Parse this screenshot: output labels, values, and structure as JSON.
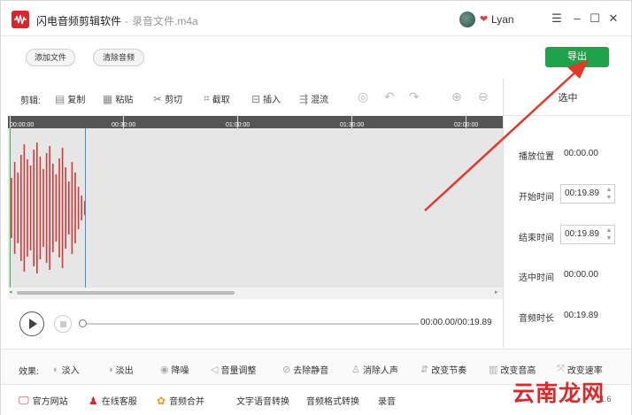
{
  "titlebar": {
    "app_name": "闪电音频剪辑软件",
    "separator": "-",
    "file_name": "录音文件.m4a",
    "user_name": "Lyan",
    "icons": [
      "app-logo-icon",
      "avatar",
      "heart-icon",
      "menu-icon",
      "minimize-icon",
      "maximize-icon",
      "close-icon"
    ]
  },
  "toolbar": {
    "add_file": "添加文件",
    "clear_audio": "清除音频",
    "export": "导出",
    "accent_color": "#1fa34a"
  },
  "edit": {
    "label": "剪辑:",
    "copy": "复制",
    "paste": "粘贴",
    "cut": "剪切",
    "crop": "截取",
    "insert": "插入",
    "mix": "混流"
  },
  "ruler": {
    "labels": [
      "00:00:00",
      "00:30:00",
      "01:00:00",
      "01:30:00",
      "02:00:00"
    ]
  },
  "panel": {
    "title": "选中",
    "play_position_label": "播放位置",
    "play_position": "00:00.00",
    "start_time_label": "开始时间",
    "start_time": "00:19.89",
    "end_time_label": "结束时间",
    "end_time": "00:19.89",
    "selected_time_label": "选中时间",
    "selected_time": "00:00.00",
    "duration_label": "音频时长",
    "duration": "00:19.89"
  },
  "playback": {
    "timecode": "00:00.00/00:19.89"
  },
  "effects": {
    "label": "效果:",
    "fade_in": "淡入",
    "fade_out": "淡出",
    "noise_reduction": "降噪",
    "volume": "音量调整",
    "remove_silence": "去除静音",
    "remove_vocals": "消除人声",
    "change_tempo": "改变节奏",
    "change_pitch": "改变音高",
    "change_speed": "改变速率"
  },
  "bottom": {
    "website": "官方网站",
    "support": "在线客服",
    "merge": "音频合并",
    "tts": "文字语音转换",
    "format": "音频格式转换",
    "record": "录音",
    "version": "1.6"
  },
  "watermark": "云南龙网",
  "colors": {
    "waveform": "#d33a3a",
    "start_marker": "#3cb050",
    "end_marker": "#3d8fd9",
    "arrow": "#e23a2a"
  }
}
